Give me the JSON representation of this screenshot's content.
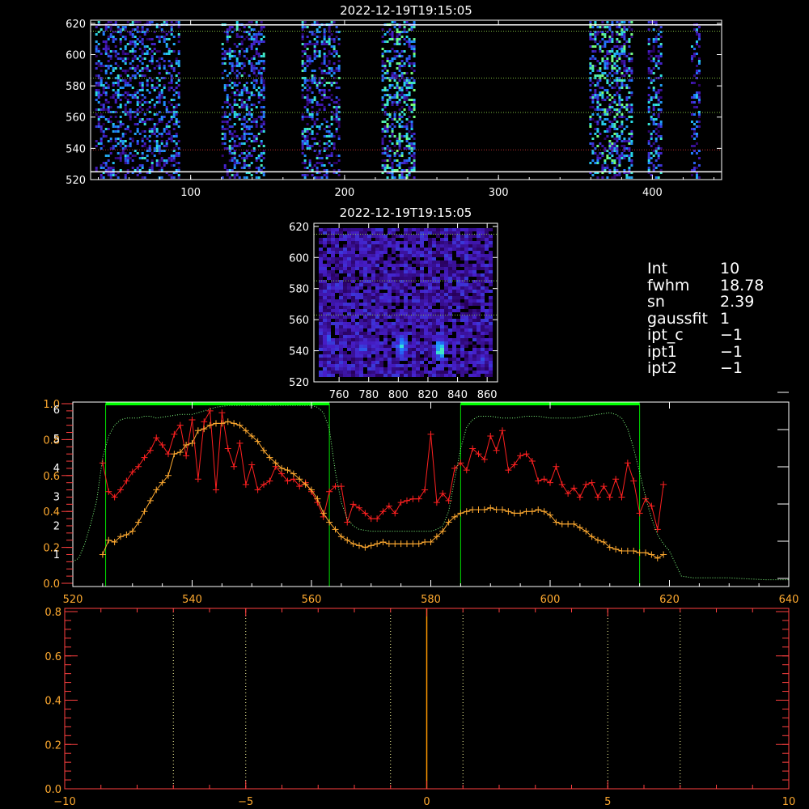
{
  "colors": {
    "background": "#000000",
    "axis": "#ffffff",
    "axis_lower": "#ff4040",
    "red_series": "#ff2020",
    "orange_series": "#ffaa30",
    "dotted_green": "#80ff80",
    "band_bar": "#00ff00",
    "band_line": "#00e000",
    "row_green": "#80c040",
    "row_red": "#c03030",
    "vline": "#ffffa0",
    "center_line": "#ff9900"
  },
  "info_panel": {
    "int_label": "Int",
    "int_value": "10",
    "fwhm_label": "fwhm",
    "fwhm_value": "18.78",
    "sn_label": "sn",
    "sn_value": "2.39",
    "gaussfit_label": "gaussfit",
    "gaussfit_value": "1",
    "ipt_c_label": "ipt_c",
    "ipt_c_value": "−1",
    "ipt1_label": "ipt1",
    "ipt1_value": "−1",
    "ipt2_label": "ipt2",
    "ipt2_value": "−1"
  },
  "chart_data": [
    {
      "type": "heatmap",
      "title": "2022-12-19T19:15:05",
      "xlim": [
        35,
        445
      ],
      "ylim": [
        520,
        622
      ],
      "xticks": [
        100,
        200,
        300,
        400
      ],
      "yticks": [
        520,
        540,
        560,
        580,
        600,
        620
      ],
      "horizontal_lines": [
        {
          "y": 525,
          "style": "solid",
          "color": "axis"
        },
        {
          "y": 619,
          "style": "solid",
          "color": "axis"
        },
        {
          "y": 539,
          "style": "dotted",
          "color": "row_red"
        },
        {
          "y": 563,
          "style": "dotted",
          "color": "row_green"
        },
        {
          "y": 585,
          "style": "dotted",
          "color": "row_green"
        },
        {
          "y": 615,
          "style": "dotted",
          "color": "row_green"
        }
      ],
      "strips": [
        {
          "x": [
            38,
            92
          ],
          "intensity": 0.55
        },
        {
          "x": [
            120,
            147
          ],
          "intensity": 0.65
        },
        {
          "x": [
            172,
            197
          ],
          "intensity": 0.7
        },
        {
          "x": [
            224,
            245
          ],
          "intensity": 1.0
        },
        {
          "x": [
            359,
            386
          ],
          "intensity": 0.95
        },
        {
          "x": [
            397,
            406
          ],
          "intensity": 0.6
        },
        {
          "x": [
            425,
            430
          ],
          "intensity": 0.5
        }
      ]
    },
    {
      "type": "heatmap",
      "title": "2022-12-19T19:15:05",
      "xlim": [
        743,
        867
      ],
      "ylim": [
        520,
        622
      ],
      "xticks": [
        760,
        780,
        800,
        820,
        840,
        860
      ],
      "yticks": [
        520,
        540,
        560,
        580,
        600,
        620
      ],
      "horizontal_lines": [
        {
          "y": 563,
          "style": "dotted",
          "color": "row_green"
        },
        {
          "y": 585,
          "style": "dotted",
          "color": "row_green"
        },
        {
          "y": 615,
          "style": "dotted",
          "color": "row_green"
        }
      ],
      "hotspots": [
        {
          "x": 827,
          "y": 542,
          "w": 6,
          "h": 14,
          "v": 1.0
        },
        {
          "x": 801,
          "y": 545,
          "w": 6,
          "h": 16,
          "v": 0.8
        },
        {
          "x": 775,
          "y": 543,
          "w": 6,
          "h": 10,
          "v": 0.55
        },
        {
          "x": 752,
          "y": 548,
          "w": 6,
          "h": 12,
          "v": 0.55
        },
        {
          "x": 855,
          "y": 535,
          "w": 5,
          "h": 8,
          "v": 0.45
        }
      ]
    },
    {
      "type": "line",
      "xlim": [
        520,
        640
      ],
      "xticks": [
        520,
        540,
        560,
        580,
        600,
        620,
        640
      ],
      "ylim": [
        0,
        1.0
      ],
      "yticks_left": [
        0.0,
        0.2,
        0.4,
        0.6,
        0.8,
        1.0
      ],
      "yticks_left_b": [
        1,
        2,
        3,
        4,
        5,
        6
      ],
      "bands": [
        [
          525.5,
          563
        ],
        [
          585,
          615
        ]
      ],
      "series": [
        {
          "color": "red_series",
          "marker": "+",
          "x": [
            525,
            526,
            527,
            528,
            529,
            530,
            531,
            532,
            533,
            534,
            535,
            536,
            537,
            538,
            539,
            540,
            541,
            542,
            543,
            544,
            545,
            546,
            547,
            548,
            549,
            550,
            551,
            552,
            553,
            554,
            555,
            556,
            557,
            558,
            559,
            560,
            561,
            562,
            563,
            564,
            565,
            566,
            567,
            568,
            569,
            570,
            571,
            572,
            573,
            574,
            575,
            576,
            577,
            578,
            579,
            580,
            581,
            582,
            583,
            584,
            585,
            586,
            587,
            588,
            589,
            590,
            591,
            592,
            593,
            594,
            595,
            596,
            597,
            598,
            599,
            600,
            601,
            602,
            603,
            604,
            605,
            606,
            607,
            608,
            609,
            610,
            611,
            612,
            613,
            614,
            615,
            616,
            617,
            618,
            619
          ],
          "y": [
            0.67,
            0.51,
            0.48,
            0.52,
            0.57,
            0.62,
            0.65,
            0.7,
            0.74,
            0.81,
            0.77,
            0.72,
            0.83,
            0.88,
            0.71,
            0.91,
            0.58,
            0.9,
            0.96,
            0.52,
            0.95,
            0.75,
            0.65,
            0.78,
            0.55,
            0.66,
            0.52,
            0.55,
            0.57,
            0.65,
            0.61,
            0.57,
            0.58,
            0.54,
            0.56,
            0.51,
            0.45,
            0.37,
            0.51,
            0.54,
            0.54,
            0.34,
            0.44,
            0.42,
            0.39,
            0.36,
            0.36,
            0.4,
            0.43,
            0.39,
            0.45,
            0.46,
            0.47,
            0.47,
            0.52,
            0.83,
            0.45,
            0.5,
            0.46,
            0.64,
            0.67,
            0.63,
            0.75,
            0.72,
            0.69,
            0.82,
            0.74,
            0.85,
            0.63,
            0.66,
            0.71,
            0.72,
            0.68,
            0.57,
            0.58,
            0.56,
            0.65,
            0.55,
            0.5,
            0.53,
            0.48,
            0.55,
            0.56,
            0.48,
            0.54,
            0.48,
            0.58,
            0.48,
            0.67,
            0.57,
            0.39,
            0.47,
            0.43,
            0.3,
            0.55
          ]
        },
        {
          "color": "orange_series",
          "marker": "+",
          "x": [
            525,
            526,
            527,
            528,
            529,
            530,
            531,
            532,
            533,
            534,
            535,
            536,
            537,
            538,
            539,
            540,
            541,
            542,
            543,
            544,
            545,
            546,
            547,
            548,
            549,
            550,
            551,
            552,
            553,
            554,
            555,
            556,
            557,
            558,
            559,
            560,
            561,
            562,
            563,
            564,
            565,
            566,
            567,
            568,
            569,
            570,
            571,
            572,
            573,
            574,
            575,
            576,
            577,
            578,
            579,
            580,
            581,
            582,
            583,
            584,
            585,
            586,
            587,
            588,
            589,
            590,
            591,
            592,
            593,
            594,
            595,
            596,
            597,
            598,
            599,
            600,
            601,
            602,
            603,
            604,
            605,
            606,
            607,
            608,
            609,
            610,
            611,
            612,
            613,
            614,
            615,
            616,
            617,
            618,
            619
          ],
          "y": [
            0.16,
            0.24,
            0.23,
            0.26,
            0.27,
            0.29,
            0.34,
            0.4,
            0.46,
            0.52,
            0.56,
            0.6,
            0.72,
            0.73,
            0.77,
            0.78,
            0.85,
            0.86,
            0.88,
            0.89,
            0.89,
            0.9,
            0.89,
            0.88,
            0.85,
            0.82,
            0.79,
            0.74,
            0.7,
            0.67,
            0.64,
            0.63,
            0.61,
            0.58,
            0.55,
            0.52,
            0.47,
            0.39,
            0.34,
            0.3,
            0.26,
            0.24,
            0.22,
            0.21,
            0.2,
            0.21,
            0.22,
            0.23,
            0.22,
            0.22,
            0.22,
            0.22,
            0.22,
            0.22,
            0.23,
            0.23,
            0.26,
            0.29,
            0.34,
            0.37,
            0.39,
            0.4,
            0.41,
            0.41,
            0.41,
            0.42,
            0.41,
            0.41,
            0.4,
            0.39,
            0.39,
            0.4,
            0.4,
            0.41,
            0.4,
            0.38,
            0.34,
            0.33,
            0.33,
            0.33,
            0.31,
            0.29,
            0.26,
            0.24,
            0.23,
            0.2,
            0.19,
            0.18,
            0.18,
            0.18,
            0.17,
            0.17,
            0.16,
            0.14,
            0.16
          ]
        },
        {
          "color": "dotted_green",
          "marker": "none",
          "style": "dotted",
          "x": [
            520,
            521,
            522,
            523,
            524,
            525,
            526,
            527,
            528,
            529,
            530,
            531,
            532,
            533,
            534,
            536,
            538,
            540,
            542,
            544,
            546,
            548,
            550,
            552,
            554,
            556,
            558,
            559,
            560,
            561,
            562,
            563,
            564,
            565,
            566,
            567,
            568,
            570,
            572,
            574,
            576,
            578,
            580,
            581,
            582,
            583,
            584,
            585,
            586,
            587,
            588,
            590,
            592,
            594,
            596,
            598,
            600,
            602,
            604,
            606,
            608,
            610,
            611,
            612,
            613,
            614,
            615,
            616,
            617,
            618,
            619,
            620,
            621,
            622,
            624,
            630,
            636,
            640
          ],
          "y": [
            0.12,
            0.14,
            0.22,
            0.33,
            0.46,
            0.7,
            0.82,
            0.88,
            0.91,
            0.92,
            0.92,
            0.92,
            0.93,
            0.93,
            0.92,
            0.93,
            0.94,
            0.94,
            0.96,
            0.98,
            0.99,
            0.99,
            0.99,
            0.99,
            0.99,
            0.99,
            0.99,
            0.99,
            0.99,
            0.98,
            0.95,
            0.86,
            0.62,
            0.45,
            0.36,
            0.32,
            0.3,
            0.29,
            0.29,
            0.29,
            0.29,
            0.29,
            0.29,
            0.3,
            0.32,
            0.4,
            0.58,
            0.75,
            0.87,
            0.91,
            0.93,
            0.93,
            0.92,
            0.92,
            0.93,
            0.93,
            0.92,
            0.92,
            0.92,
            0.93,
            0.94,
            0.95,
            0.94,
            0.92,
            0.86,
            0.75,
            0.62,
            0.48,
            0.36,
            0.27,
            0.22,
            0.18,
            0.11,
            0.04,
            0.03,
            0.03,
            0.02,
            0.02
          ]
        }
      ]
    },
    {
      "type": "line",
      "xlim": [
        -10,
        10
      ],
      "xticks": [
        -10,
        -5,
        0,
        5,
        10
      ],
      "ylim": [
        0,
        0.8
      ],
      "yticks": [
        0.0,
        0.2,
        0.4,
        0.6,
        0.8
      ],
      "vertical_lines": [
        {
          "x": -7,
          "style": "dotted",
          "color": "vline"
        },
        {
          "x": -5,
          "style": "dotted",
          "color": "vline"
        },
        {
          "x": -1,
          "style": "dotted",
          "color": "vline"
        },
        {
          "x": 0,
          "style": "solid",
          "color": "center_line"
        },
        {
          "x": 1,
          "style": "dotted",
          "color": "vline"
        },
        {
          "x": 5,
          "style": "dotted",
          "color": "vline"
        },
        {
          "x": 7,
          "style": "dotted",
          "color": "vline"
        }
      ]
    }
  ]
}
